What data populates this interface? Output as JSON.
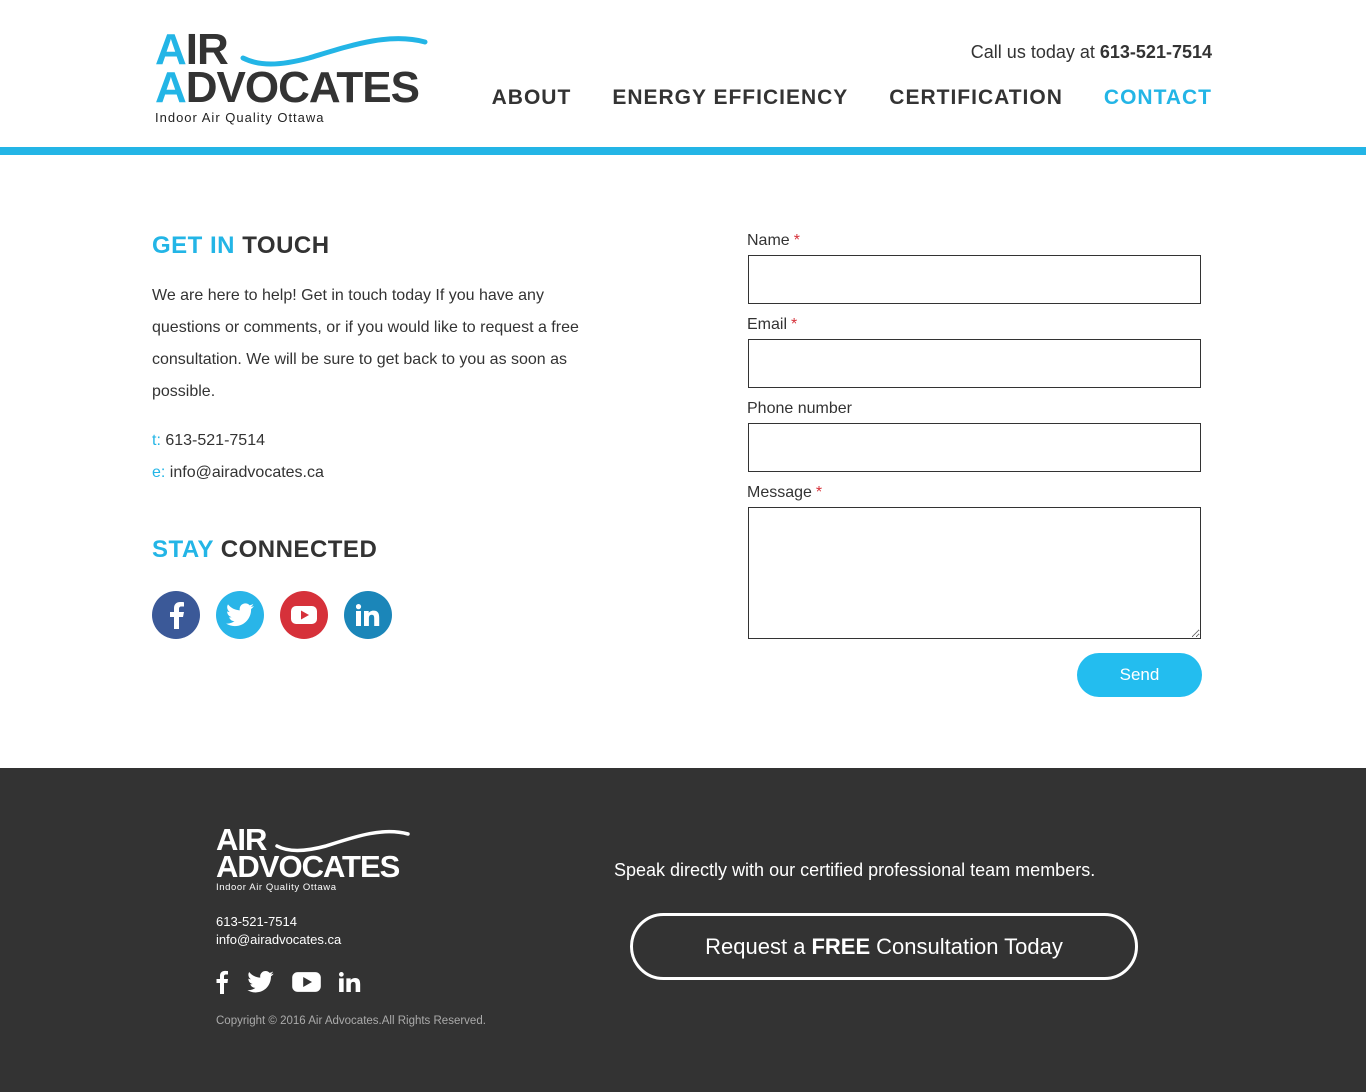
{
  "brand": {
    "logo_line1_accent": "A",
    "logo_line1_rest": "IR",
    "logo_line2_accent": "A",
    "logo_line2_rest": "DVOCATES",
    "tagline": "Indoor Air Quality Ottawa",
    "accent_color": "#23b5e6",
    "dark_color": "#333333"
  },
  "header": {
    "call_prefix": "Call us today at",
    "call_number": "613-521-7514",
    "nav": [
      {
        "label": "ABOUT",
        "active": false
      },
      {
        "label": "ENERGY EFFICIENCY",
        "active": false
      },
      {
        "label": "CERTIFICATION",
        "active": false
      },
      {
        "label": "CONTACT",
        "active": true
      }
    ]
  },
  "main": {
    "touch_title_light": "GET IN",
    "touch_title_bold": "TOUCH",
    "intro": "We are here to help! Get in touch today If you have any questions or comments, or if you would like to request a free consultation. We will be sure to get back to you as soon as possible.",
    "phone_key": "t:",
    "phone": "613-521-7514",
    "email_key": "e:",
    "email": "info@airadvocates.ca",
    "connected_title_light": "STAY",
    "connected_title_bold": "CONNECTED",
    "socials": [
      {
        "icon": "facebook-icon",
        "color": "#3b5998"
      },
      {
        "icon": "twitter-icon",
        "color": "#29b5e8"
      },
      {
        "icon": "youtube-icon",
        "color": "#d6313a"
      },
      {
        "icon": "linkedin-icon",
        "color": "#1b86b9"
      }
    ]
  },
  "form": {
    "name_label": "Name",
    "email_label": "Email",
    "phone_label": "Phone number",
    "message_label": "Message",
    "required_mark": "*",
    "name_value": "",
    "email_value": "",
    "phone_value": "",
    "message_value": "",
    "send_label": "Send"
  },
  "footer": {
    "logo_line1": "AIR",
    "logo_line2": "ADVOCATES",
    "tagline": "Indoor Air Quality Ottawa",
    "phone": "613-521-7514",
    "email": "info@airadvocates.ca",
    "copyright": "Copyright © 2016 Air Advocates.All Rights Reserved.",
    "speak": "Speak directly with our certified professional team members.",
    "cta_prefix": "Request a",
    "cta_bold": "FREE",
    "cta_suffix": "Consultation Today"
  }
}
